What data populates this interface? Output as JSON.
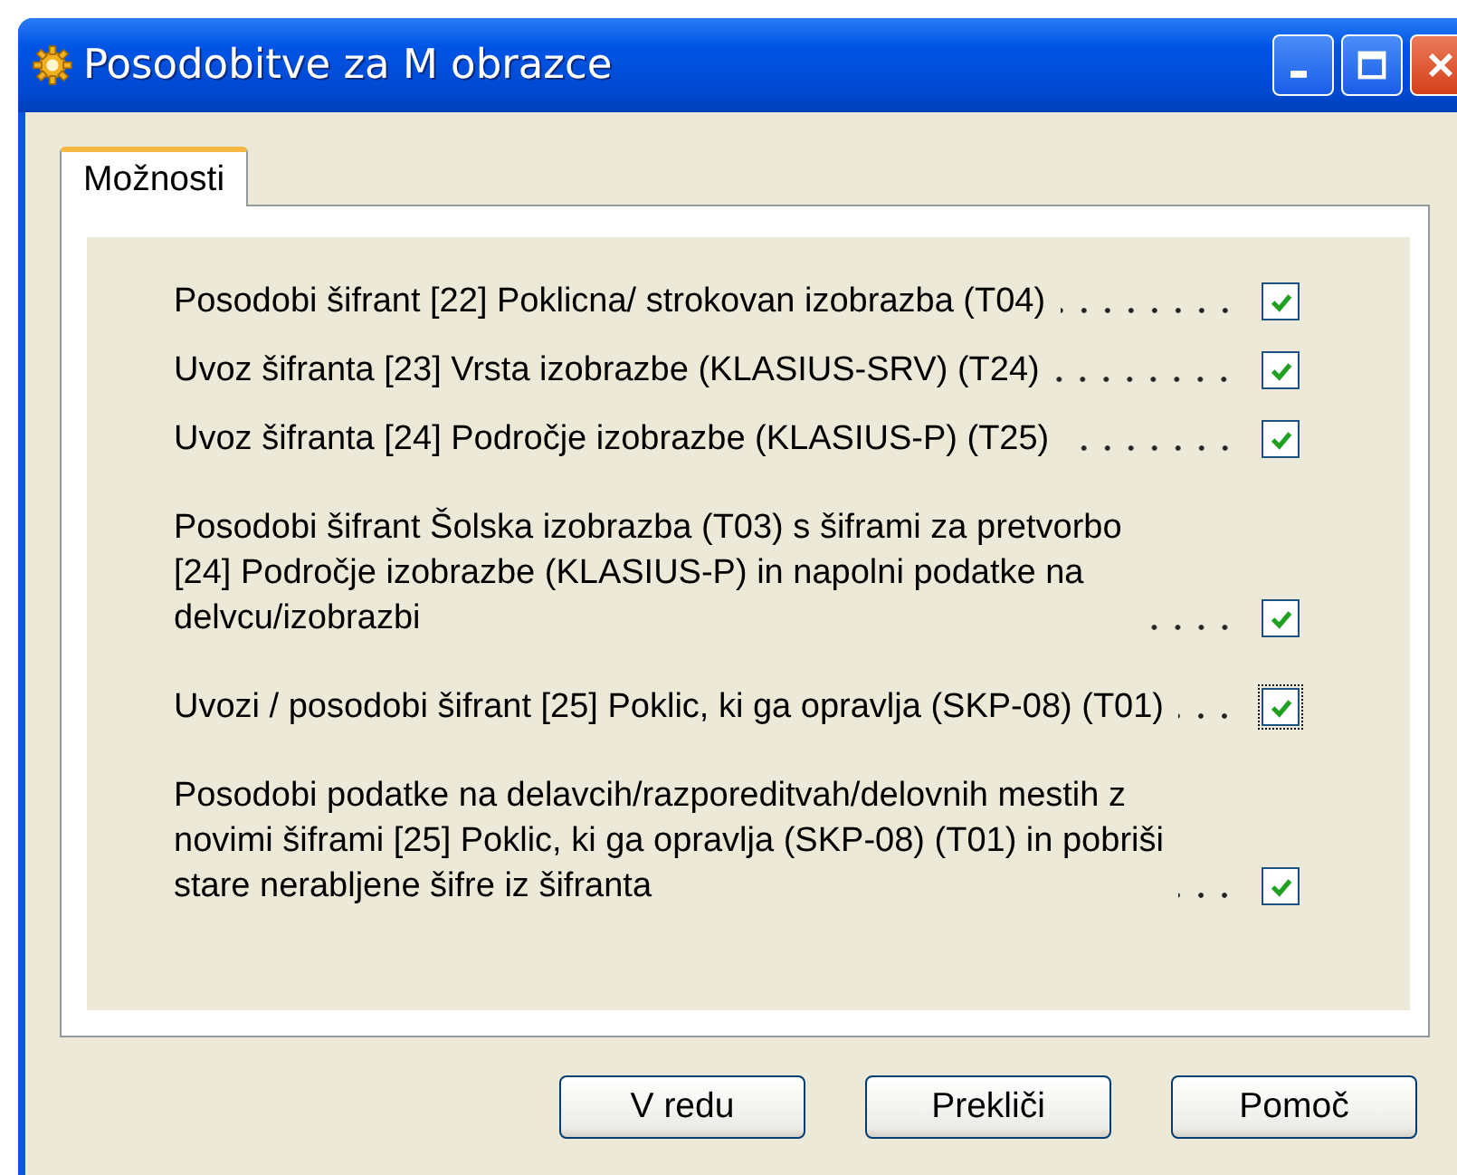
{
  "window": {
    "title": "Posodobitve za M obrazce"
  },
  "tabs": [
    {
      "label": "Možnosti",
      "selected": true
    }
  ],
  "option_groups": [
    {
      "options": [
        {
          "label": "Posodobi šifrant  [22] Poklicna/ strokovan izobrazba (T04)",
          "checked": true,
          "focused": false
        },
        {
          "label": "Uvoz šifranta  [23] Vrsta izobrazbe (KLASIUS-SRV) (T24)",
          "checked": true,
          "focused": false
        },
        {
          "label": "Uvoz šifranta  [24] Področje izobrazbe (KLASIUS-P) (T25)",
          "checked": true,
          "focused": false
        }
      ]
    },
    {
      "options": [
        {
          "label": "Posodobi šifrant  Šolska izobrazba (T03) s šiframi za pretvorbo\n[24] Področje izobrazbe (KLASIUS-P) in napolni podatke na\ndelvcu/izobrazbi",
          "checked": true,
          "focused": false
        }
      ]
    },
    {
      "options": [
        {
          "label": "Uvozi / posodobi šifrant  [25] Poklic, ki ga opravlja (SKP-08) (T01)",
          "checked": true,
          "focused": true
        }
      ]
    },
    {
      "options": [
        {
          "label": "Posodobi podatke na delavcih/razporeditvah/delovnih mestih z\nnovimi šiframi [25] Poklic, ki ga opravlja (SKP-08) (T01) in pobriši\nstare nerabljene šifre iz šifranta",
          "checked": true,
          "focused": false
        }
      ]
    }
  ],
  "buttons": [
    "V redu",
    "Prekliči",
    "Pomoč"
  ]
}
